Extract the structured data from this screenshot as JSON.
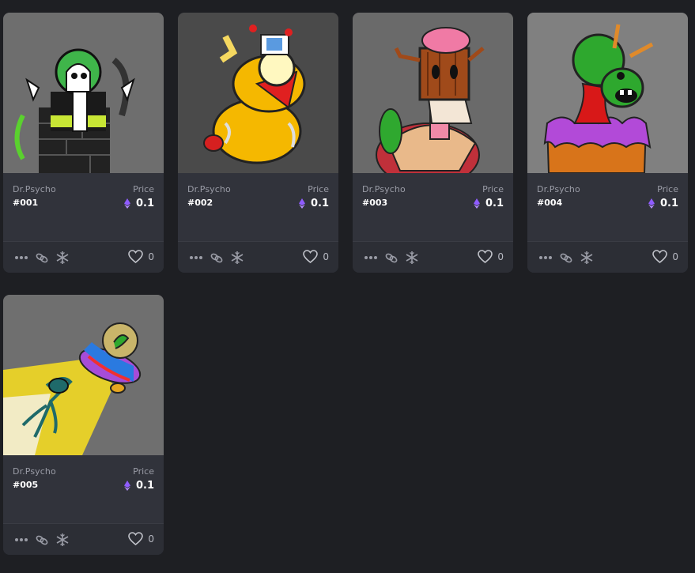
{
  "cards": [
    {
      "creator": "Dr.Psycho",
      "token": "#001",
      "price_label": "Price",
      "price": "0.1",
      "likes": "0",
      "bg": "#6e6e6e"
    },
    {
      "creator": "Dr.Psycho",
      "token": "#002",
      "price_label": "Price",
      "price": "0.1",
      "likes": "0",
      "bg": "#4a4a4a"
    },
    {
      "creator": "Dr.Psycho",
      "token": "#003",
      "price_label": "Price",
      "price": "0.1",
      "likes": "0",
      "bg": "#6a6a6a"
    },
    {
      "creator": "Dr.Psycho",
      "token": "#004",
      "price_label": "Price",
      "price": "0.1",
      "likes": "0",
      "bg": "#808080"
    },
    {
      "creator": "Dr.Psycho",
      "token": "#005",
      "price_label": "Price",
      "price": "0.1",
      "likes": "0",
      "bg": "#6f6f6f"
    }
  ],
  "icons": {
    "more": "more-dots-icon",
    "link": "chain-link-icon",
    "freeze": "snowflake-icon",
    "like": "heart-icon",
    "currency": "ethereum-icon"
  },
  "colors": {
    "page_bg": "#1e1f23",
    "card_bg": "#2c2e35",
    "eth": "#8f5cff"
  }
}
